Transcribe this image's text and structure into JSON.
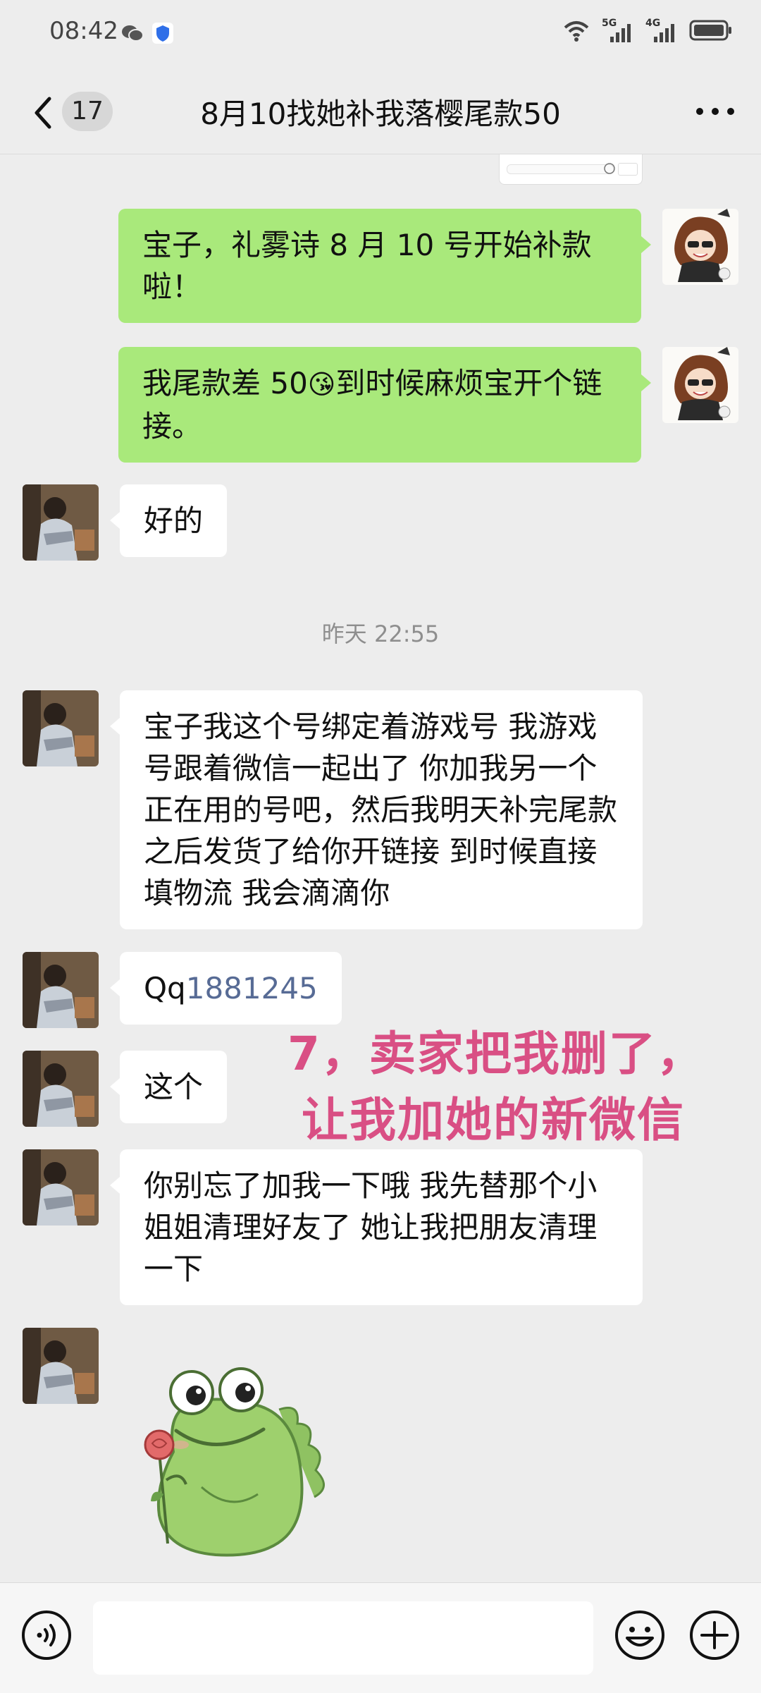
{
  "status_bar": {
    "time": "08:42",
    "wechat_icon": "wechat-icon",
    "shield_icon": "shield-icon",
    "network_1": "5G",
    "network_2": "4G"
  },
  "header": {
    "unread_count": "17",
    "title": "8月10找她补我落樱尾款50",
    "back_icon": "chevron-left-icon",
    "more_icon": "more-horizontal-icon"
  },
  "messages": [
    {
      "sender": "me",
      "text": "宝子，礼雾诗 8 月 10 号开始补款啦！"
    },
    {
      "sender": "me",
      "text_before": "我尾款差 50",
      "emoji": "😘",
      "text_after": "到时候麻烦宝开个链接。"
    },
    {
      "sender": "other",
      "text": "好的"
    },
    {
      "type": "timestamp",
      "text": "昨天 22:55"
    },
    {
      "sender": "other",
      "text": "宝子我这个号绑定着游戏号 我游戏号跟着微信一起出了 你加我另一个正在用的号吧，然后我明天补完尾款之后发货了给你开链接 到时候直接填物流 我会滴滴你"
    },
    {
      "sender": "other",
      "text_prefix": "Qq",
      "text_number": "1881245"
    },
    {
      "sender": "other",
      "text": "这个"
    },
    {
      "sender": "other",
      "text": "你别忘了加我一下哦 我先替那个小姐姐清理好友了 她让我把朋友清理一下"
    },
    {
      "sender": "other",
      "type": "sticker",
      "sticker": "frog-holding-rose-sticker"
    }
  ],
  "annotation": {
    "line1": "7，卖家把我删了，",
    "line2": "让我加她的新微信",
    "color": "#d94f84"
  },
  "input_bar": {
    "voice_icon": "voice-icon",
    "emoji_icon": "emoji-icon",
    "plus_icon": "plus-icon"
  },
  "colors": {
    "my_bubble": "#a9e97b",
    "other_bubble": "#ffffff",
    "background": "#ededed",
    "link": "#576b95"
  }
}
